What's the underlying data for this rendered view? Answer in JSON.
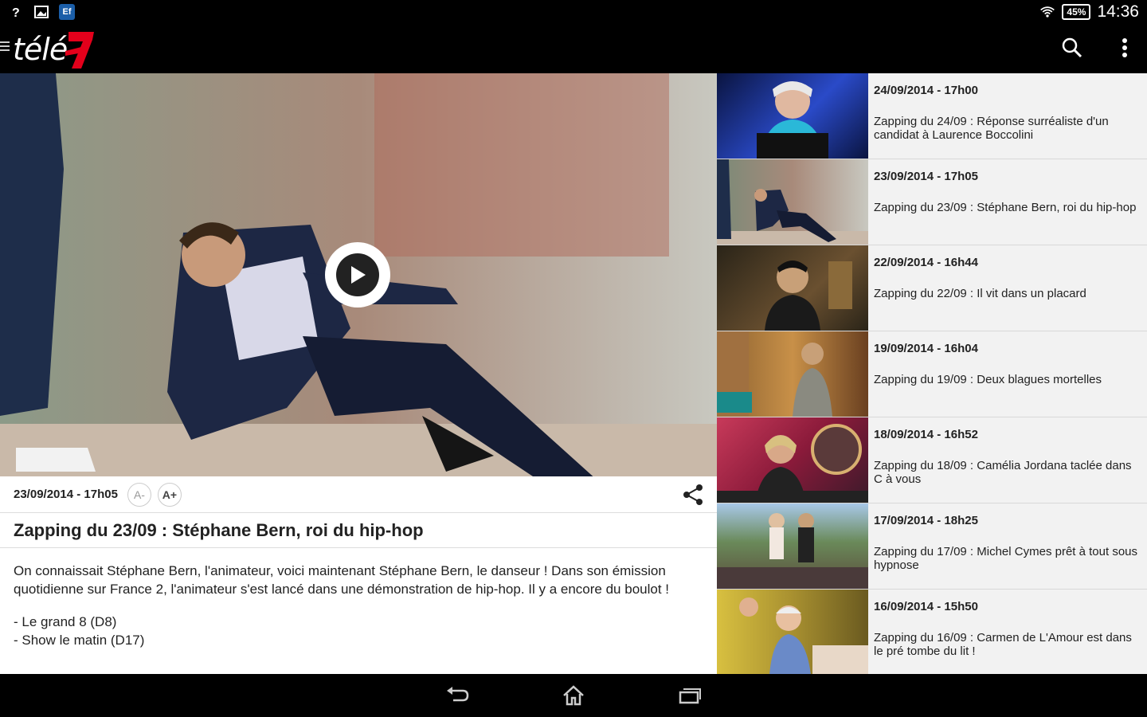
{
  "status_bar": {
    "icons": [
      "wifi-question-icon",
      "image-icon",
      "app-ef-icon",
      "wifi-icon",
      "battery-icon"
    ],
    "app_badge": "Ef",
    "battery": "45%",
    "time": "14:36"
  },
  "app_bar": {
    "logo_text": "télé",
    "logo_number": "7",
    "actions": [
      "search-icon",
      "overflow-menu-icon"
    ]
  },
  "article": {
    "date": "23/09/2014 - 17h05",
    "font_smaller": "A-",
    "font_larger": "A+",
    "title": "Zapping du 23/09 : Stéphane Bern, roi du hip-hop",
    "paragraph": "On connaissait Stéphane Bern, l'animateur, voici maintenant Stéphane Bern, le danseur ! Dans son émission quotidienne sur France 2, l'animateur s'est lancé dans une démonstration de hip-hop. Il y a encore du boulot !",
    "list": [
      "- Le grand 8 (D8)",
      "- Show le matin (D17)"
    ]
  },
  "sidebar": {
    "items": [
      {
        "date": "24/09/2014 - 17h00",
        "title": "Zapping du 24/09 : Réponse surréaliste d'un candidat à Laurence Boccolini",
        "thumb_color": "#1a2a6e"
      },
      {
        "date": "23/09/2014 - 17h05",
        "title": "Zapping du 23/09 : Stéphane Bern, roi du hip-hop",
        "thumb_color": "#8a8a86"
      },
      {
        "date": "22/09/2014 - 16h44",
        "title": "Zapping du 22/09 : Il vit dans un placard",
        "thumb_color": "#4a3a26"
      },
      {
        "date": "19/09/2014 - 16h04",
        "title": "Zapping du 19/09 : Deux blagues mortelles",
        "thumb_color": "#7a5a2a"
      },
      {
        "date": "18/09/2014 - 16h52",
        "title": "Zapping du 18/09 : Camélia Jordana taclée dans C à vous",
        "thumb_color": "#6a2a3a"
      },
      {
        "date": "17/09/2014 - 18h25",
        "title": "Zapping du 17/09 : Michel Cymes prêt à tout sous hypnose",
        "thumb_color": "#6a7a5a"
      },
      {
        "date": "16/09/2014 - 15h50",
        "title": "Zapping du 16/09 : Carmen de L'Amour est dans le pré tombe du lit !",
        "thumb_color": "#8a7a3a"
      }
    ]
  },
  "nav_bar": {
    "buttons": [
      "back-icon",
      "home-icon",
      "recents-icon"
    ]
  },
  "colors": {
    "accent": "#e3001b",
    "background": "#000000"
  }
}
